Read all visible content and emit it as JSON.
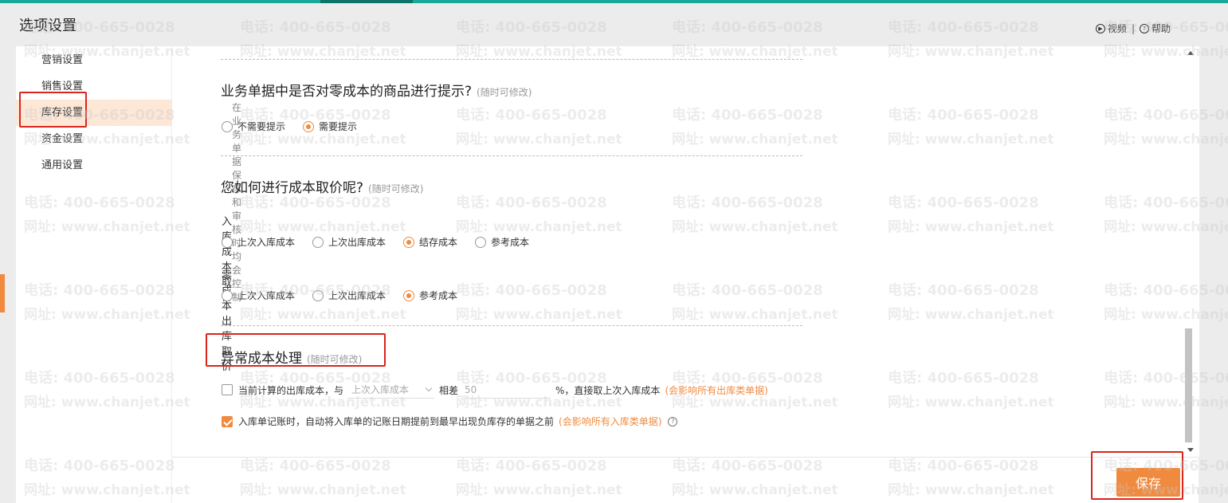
{
  "page": {
    "title": "选项设置",
    "video_link": "视频",
    "help_link": "帮助",
    "link_separator": "|"
  },
  "sidebar": {
    "items": [
      {
        "label": "营销设置",
        "active": false
      },
      {
        "label": "销售设置",
        "active": false
      },
      {
        "label": "库存设置",
        "active": true
      },
      {
        "label": "资金设置",
        "active": false
      },
      {
        "label": "通用设置",
        "active": false
      }
    ]
  },
  "zero_cost_prompt": {
    "title": "业务单据中是否对零成本的商品进行提示?",
    "note": "(随时可修改)",
    "description": "在业务单据保存和审核时均会控制",
    "options": [
      {
        "label": "不需要提示",
        "selected": false
      },
      {
        "label": "需要提示",
        "selected": true
      }
    ]
  },
  "cost_pricing": {
    "title": "您如何进行成本取价呢?",
    "note": "(随时可修改)",
    "inbound": {
      "label": "入库成本取价",
      "options": [
        {
          "label": "上次入库成本",
          "selected": false
        },
        {
          "label": "上次出库成本",
          "selected": false
        },
        {
          "label": "结存成本",
          "selected": true
        },
        {
          "label": "参考成本",
          "selected": false
        }
      ]
    },
    "zero_outbound": {
      "label": "零成本出库取价",
      "options": [
        {
          "label": "上次入库成本",
          "selected": false
        },
        {
          "label": "上次出库成本",
          "selected": false
        },
        {
          "label": "参考成本",
          "selected": true
        }
      ]
    }
  },
  "abnormal_cost": {
    "title": "异常成本处理",
    "note": "(随时可修改)",
    "rule1": {
      "checked": false,
      "prefix": "当前计算的出库成本，与",
      "select_value": "上次入库成本",
      "middle": "相差",
      "threshold": "50",
      "suffix": "%，直接取上次入库成本",
      "warning": "(会影响所有出库类单据)"
    },
    "rule2": {
      "checked": true,
      "text": "入库单记账时，自动将入库单的记账日期提前到最早出现负库存的单据之前",
      "warning": "(会影响所有入库类单据)"
    }
  },
  "footer": {
    "save_label": "保存"
  },
  "watermark": {
    "phone": "电话: 400-665-0028",
    "site": "网址: www.chanjet.net"
  },
  "colors": {
    "accent": "#f08a3e",
    "top_strip": "#1aa898",
    "highlight_box": "#d9251d",
    "active_item_bg": "#fde7d6"
  }
}
